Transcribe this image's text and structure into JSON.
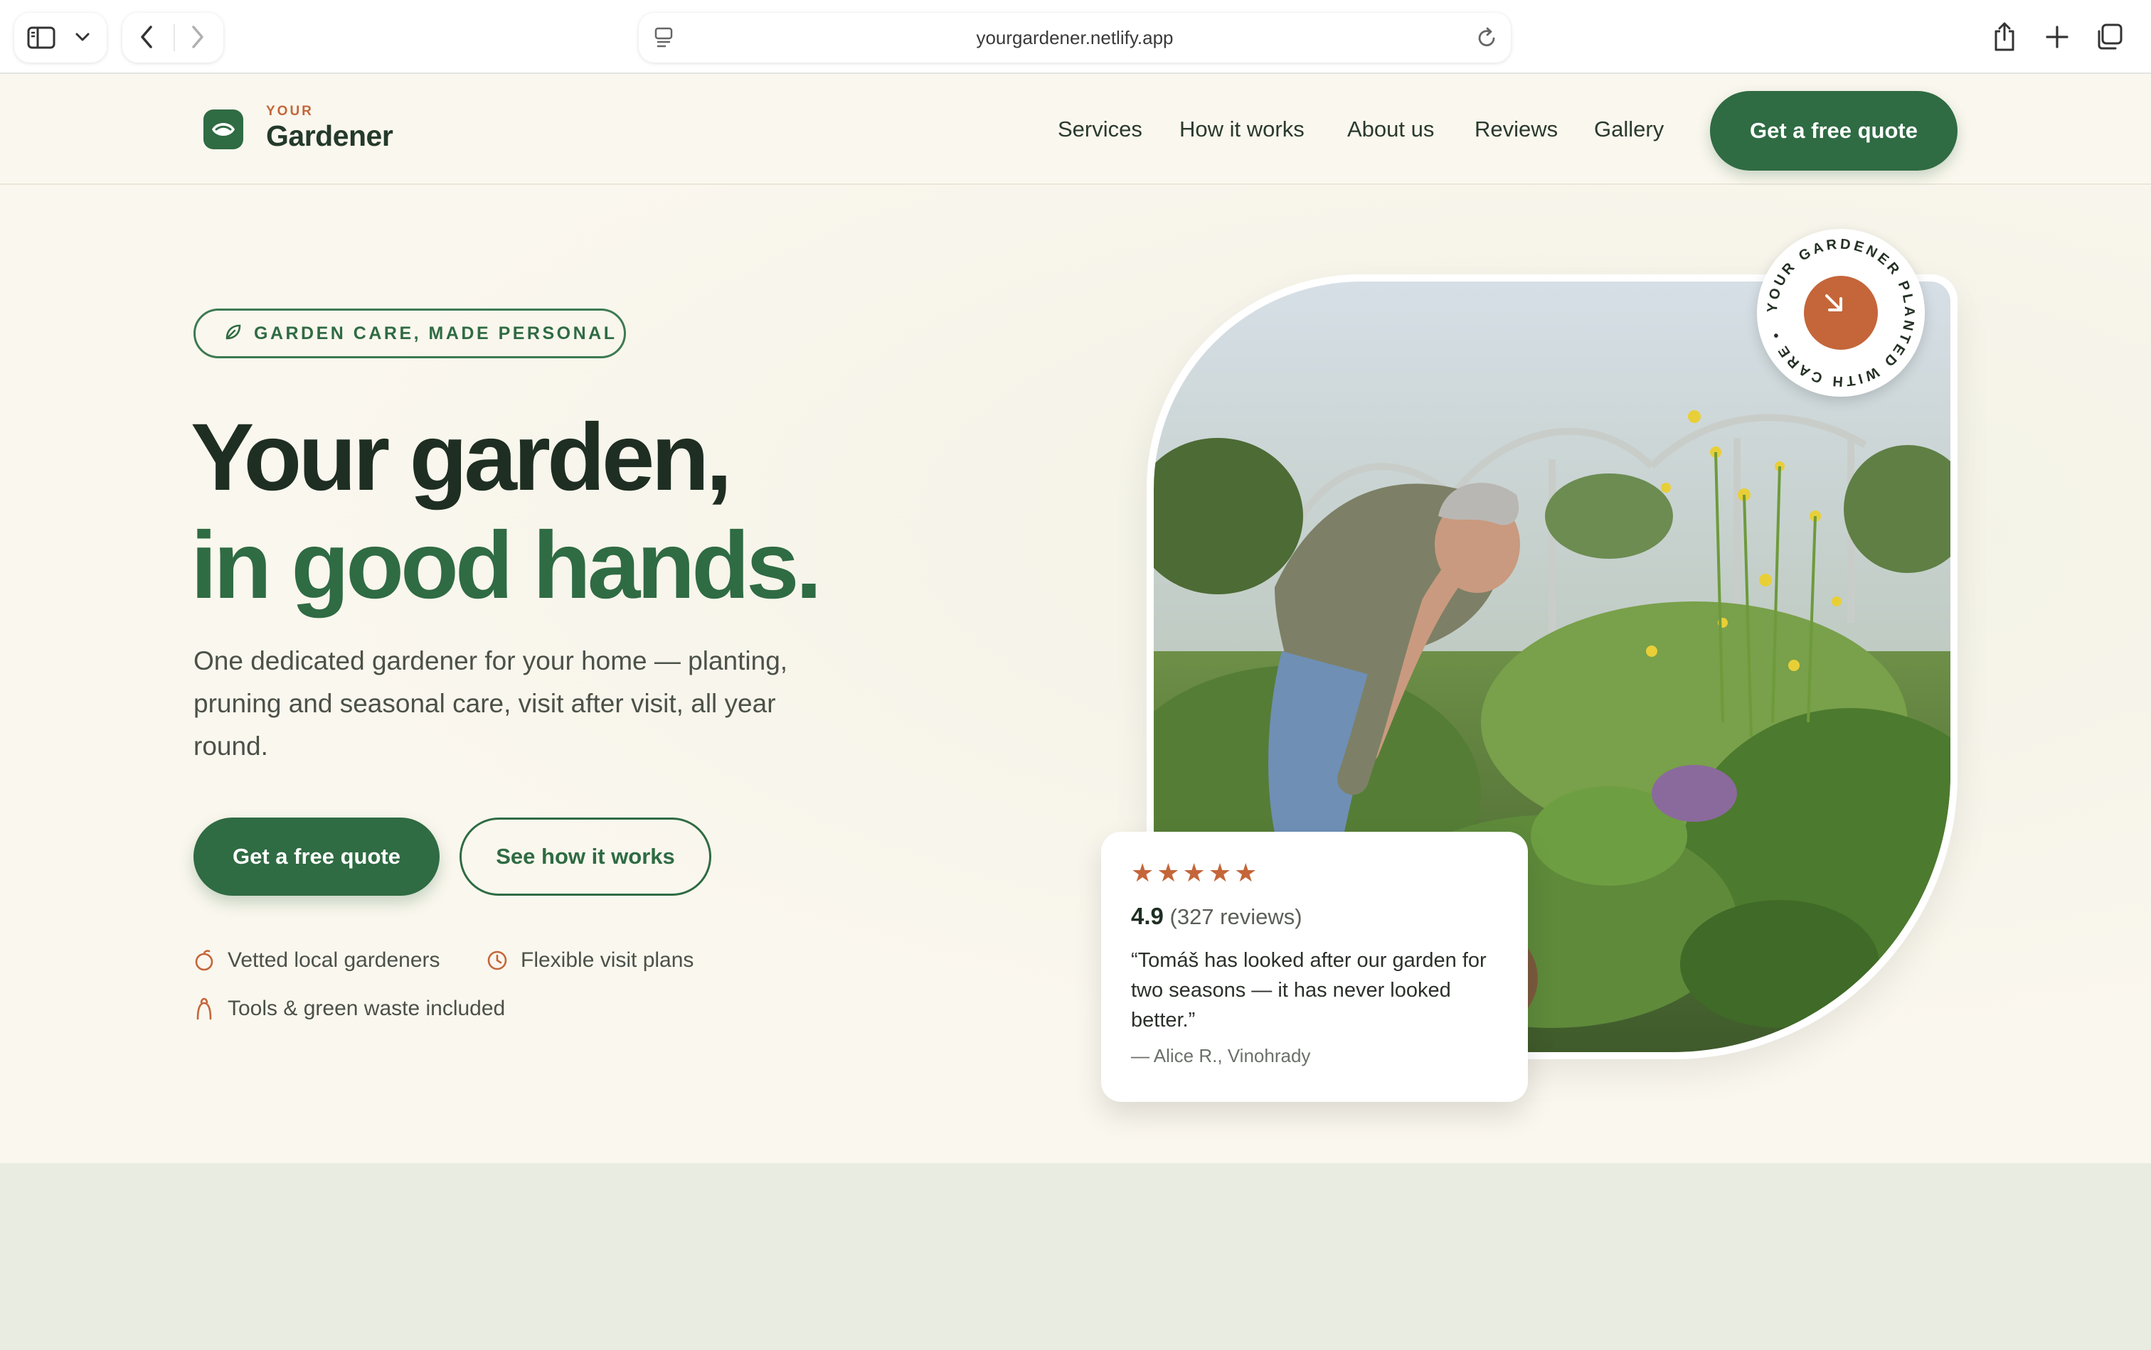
{
  "browser": {
    "url": "yourgardener.netlify.app",
    "icons": [
      "sidebar-icon",
      "chevron-down-icon",
      "back-icon",
      "forward-icon",
      "page-icon",
      "reload-icon",
      "share-icon",
      "new-tab-icon",
      "tabs-overview-icon"
    ]
  },
  "brand": {
    "small": "YOUR",
    "name": "Gardener",
    "color_primary": "#2f6b43",
    "color_accent": "#c4663a"
  },
  "nav": {
    "items": [
      {
        "label": "Services"
      },
      {
        "label": "How it works"
      },
      {
        "label": "About us"
      },
      {
        "label": "Reviews"
      },
      {
        "label": "Gallery"
      }
    ],
    "cta": "Get a free quote"
  },
  "hero": {
    "badge": "GARDEN CARE, MADE PERSONAL",
    "headline_line1": "Your garden,",
    "headline_line2": "in good hands.",
    "lede": "One dedicated gardener for your home — planting, pruning and seasonal care, visit after visit, all year round.",
    "primary_cta": "Get a free quote",
    "secondary_cta": "See how it works",
    "features": [
      {
        "label": "Vetted local gardeners",
        "icon": "leaf-icon"
      },
      {
        "label": "Flexible visit plans",
        "icon": "clock-icon"
      },
      {
        "label": "Tools & green waste included",
        "icon": "tool-icon"
      }
    ]
  },
  "seal": {
    "text": "YOUR GARDENER PLANTED WITH CARE •",
    "icon": "arrow-down-right-icon"
  },
  "review": {
    "stars": "★★★★★",
    "rating": 4.9,
    "score": "4.9",
    "count_text": "(327 reviews)",
    "quote": "“Tomáš has looked after our garden for two seasons — it has never looked better.”",
    "author": "— Alice R., Vinohrady"
  }
}
